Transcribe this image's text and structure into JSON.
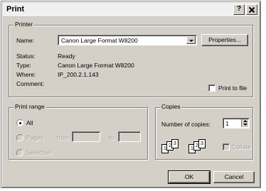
{
  "dialog": {
    "title": "Print",
    "help_glyph": "?"
  },
  "printer": {
    "group_label": "Printer",
    "name_label": "Name:",
    "name_value": "Canon Large Format W8200",
    "properties_button": "Properties...",
    "status_label": "Status:",
    "status_value": "Ready",
    "type_label": "Type:",
    "type_value": "Canon Large Format W8200",
    "where_label": "Where:",
    "where_value": "IP_200.2.1.143",
    "comment_label": "Comment:",
    "print_to_file_label": "Print to file"
  },
  "print_range": {
    "group_label": "Print range",
    "all_label": "All",
    "pages_label": "Pages",
    "from_label": "from:",
    "to_label": "to:",
    "selection_label": "Selection"
  },
  "copies": {
    "group_label": "Copies",
    "number_label": "Number of copies:",
    "number_value": "1",
    "collate_label": "Collate",
    "collate_icon_pages": [
      "1",
      "2",
      "3"
    ]
  },
  "buttons": {
    "ok": "OK",
    "cancel": "Cancel"
  }
}
